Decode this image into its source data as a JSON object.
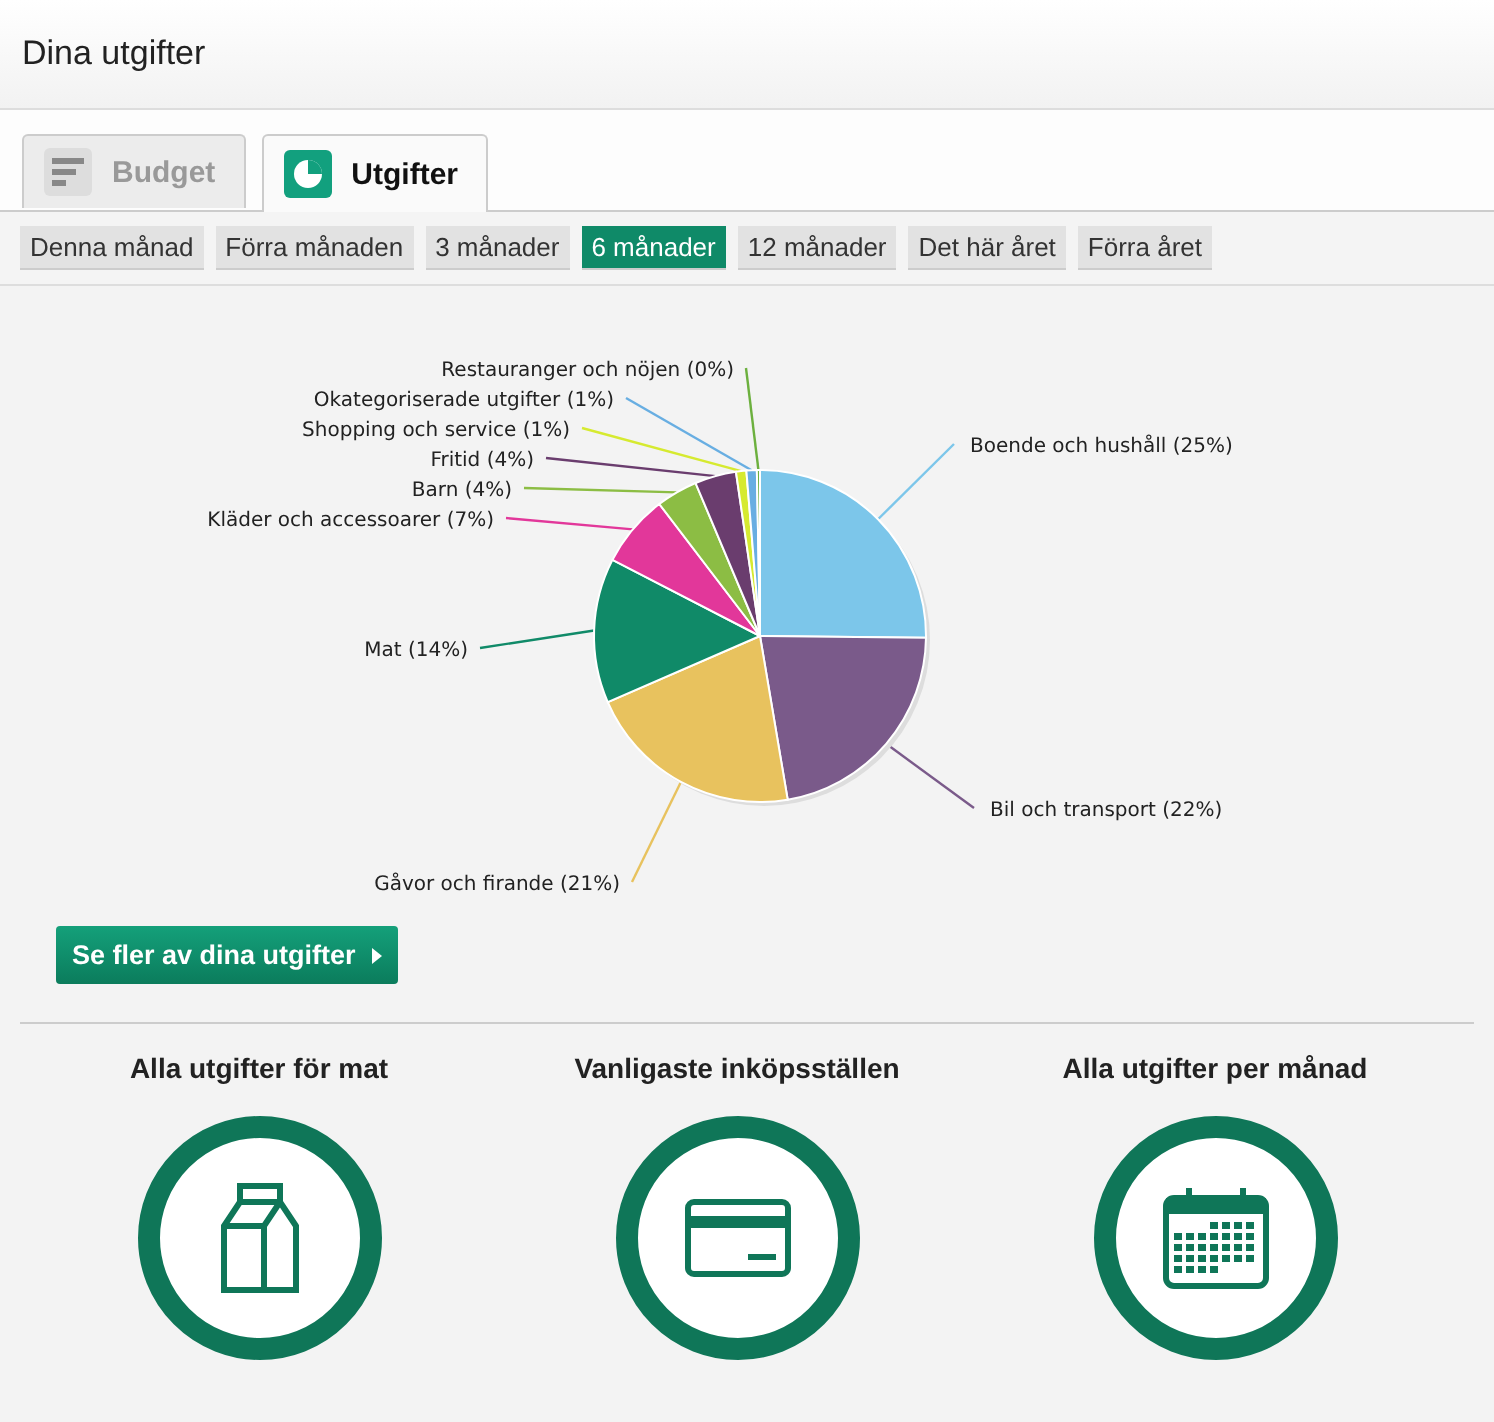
{
  "header": {
    "title": "Dina utgifter"
  },
  "tabs": [
    {
      "label": "Budget",
      "selected": false
    },
    {
      "label": "Utgifter",
      "selected": true
    }
  ],
  "periods": [
    {
      "label": "Denna månad",
      "selected": false
    },
    {
      "label": "Förra månaden",
      "selected": false
    },
    {
      "label": "3 månader",
      "selected": false
    },
    {
      "label": "6 månader",
      "selected": true
    },
    {
      "label": "12 månader",
      "selected": false
    },
    {
      "label": "Det här året",
      "selected": false
    },
    {
      "label": "Förra året",
      "selected": false
    }
  ],
  "chart": {
    "chart_data": {
      "type": "pie",
      "categories": [
        "Boende och hushåll (25%)",
        "Bil och transport (22%)",
        "Gåvor och firande (21%)",
        "Mat (14%)",
        "Kläder och accessoarer (7%)",
        "Barn (4%)",
        "Fritid (4%)",
        "Shopping och service (1%)",
        "Okategoriserade utgifter (1%)",
        "Restauranger och nöjen (0%)"
      ],
      "colors": [
        "#7cc6ea",
        "#7a5a8a",
        "#e8c25e",
        "#108a68",
        "#e2379a",
        "#8cbd44",
        "#6a3d6e",
        "#d6ea30",
        "#68aee2",
        "#6cb03e"
      ],
      "values": [
        25,
        22,
        21,
        14,
        7,
        4,
        4,
        1,
        1,
        0.3
      ]
    }
  },
  "more_button": {
    "label": "Se fler av dina utgifter"
  },
  "shortcuts": [
    {
      "title": "Alla utgifter för mat"
    },
    {
      "title": "Vanligaste inköpsställen"
    },
    {
      "title": "Alla utgifter per månad"
    }
  ]
}
